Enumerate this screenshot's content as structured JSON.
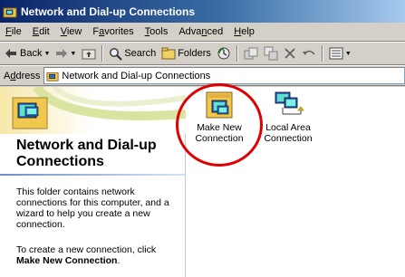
{
  "window": {
    "title": "Network and Dial-up Connections"
  },
  "menu": [
    {
      "label": "File",
      "accel": "F",
      "rest": "ile"
    },
    {
      "label": "Edit",
      "accel": "E",
      "rest": "dit"
    },
    {
      "label": "View",
      "accel": "V",
      "rest": "iew"
    },
    {
      "label": "Favorites",
      "accel": "",
      "rest": "Favorites",
      "ul_index": 1
    },
    {
      "label": "Tools",
      "accel": "T",
      "rest": "ools"
    },
    {
      "label": "Advanced",
      "accel": "",
      "rest": "Advanced",
      "ul_index": 3
    },
    {
      "label": "Help",
      "accel": "H",
      "rest": "elp"
    }
  ],
  "toolbar": {
    "back_label": "Back",
    "search_label": "Search",
    "folders_label": "Folders"
  },
  "address": {
    "label_accel": "d",
    "label": "Address",
    "value": "Network and Dial-up Connections"
  },
  "leftpane": {
    "title": "Network and Dial-up Connections",
    "description": "This folder contains network connections for this computer, and a wizard to help you create a new connection.",
    "instruction_prefix": "To create a new connection, click",
    "instruction_link": "Make New Connection",
    "instruction_suffix": "."
  },
  "items": [
    {
      "label": "Make New Connection",
      "icon": "make-new-connection-icon"
    },
    {
      "label": "Local Area Connection",
      "icon": "local-area-connection-icon"
    }
  ],
  "colors": {
    "title_gradient_start": "#0a246a",
    "title_gradient_end": "#a6caf0",
    "highlight": "#e00000",
    "chrome": "#d4d0c8"
  }
}
